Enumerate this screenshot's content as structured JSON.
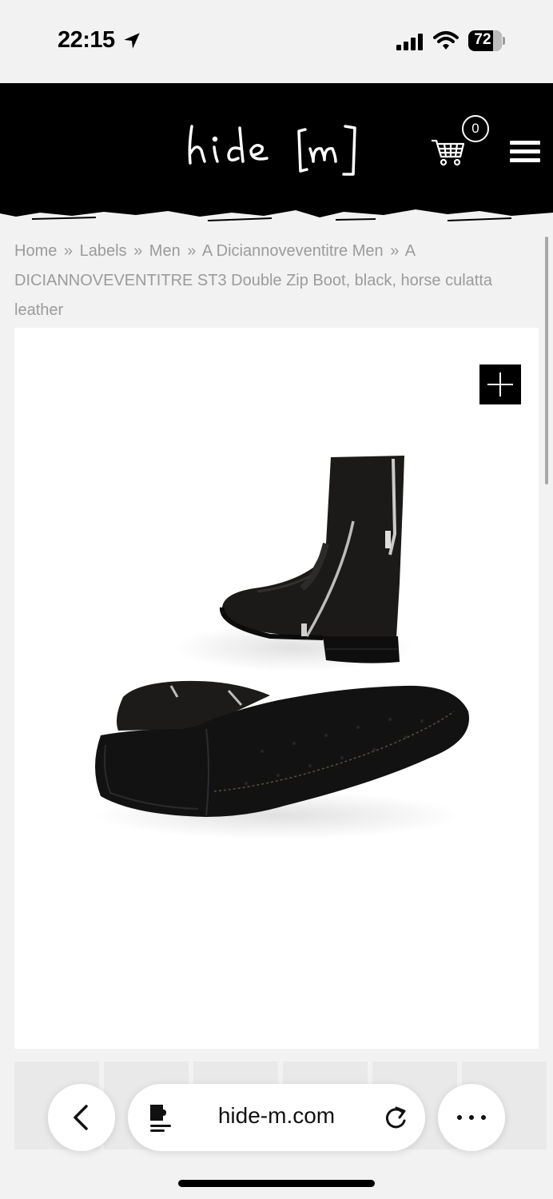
{
  "status_bar": {
    "time": "22:15",
    "battery": "72"
  },
  "header": {
    "logo_text": "hide[m]",
    "cart_count": "0"
  },
  "breadcrumb": {
    "items": [
      "Home",
      "Labels",
      "Men",
      "A Diciannoveventitre Men"
    ],
    "separator": "»",
    "current": "A DICIANNOVEVENTITRE ST3 Double Zip Boot, black, horse culatta leather"
  },
  "product": {
    "zoom_label": "+"
  },
  "browser": {
    "url": "hide-m.com"
  }
}
